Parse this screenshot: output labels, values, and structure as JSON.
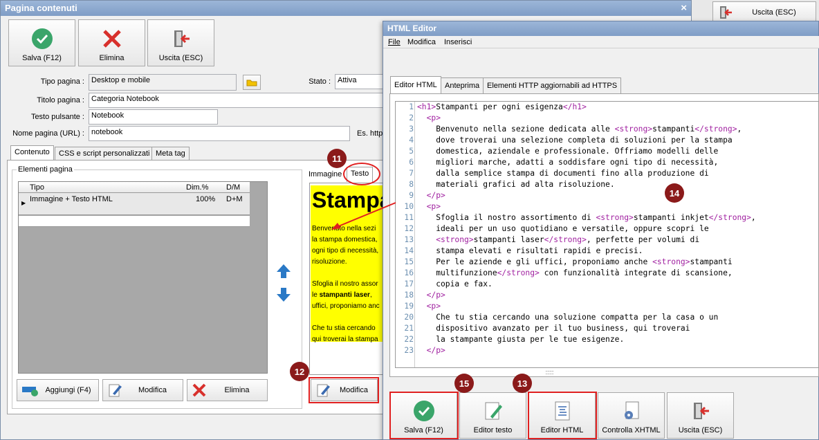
{
  "main_window": {
    "title": "Pagina contenuti",
    "close": "×",
    "toolbar": [
      {
        "label": "Salva (F12)",
        "icon": "check-icon"
      },
      {
        "label": "Elimina",
        "icon": "x-icon"
      },
      {
        "label": "Uscita (ESC)",
        "icon": "exit-icon"
      }
    ],
    "fields": {
      "tipo_pagina_label": "Tipo pagina :",
      "tipo_pagina": "Desktop e mobile",
      "titolo_label": "Titolo pagina :",
      "titolo": "Categoria Notebook",
      "testo_pulsante_label": "Testo pulsante :",
      "testo_pulsante": "Notebook",
      "nome_pagina_label": "Nome pagina (URL) :",
      "nome_pagina": "notebook",
      "stato_label": "Stato :",
      "stato": "Attiva",
      "es_label": "Es. http"
    },
    "tabs": [
      "Contenuto",
      "CSS e script personalizzati",
      "Meta tag"
    ],
    "elementi_label": "Elementi pagina",
    "grid": {
      "headers": [
        "Tipo",
        "Dim.%",
        "D/M"
      ],
      "rows": [
        {
          "tipo": "Immagine + Testo HTML",
          "dim": "100%",
          "dm": "D+M"
        }
      ]
    },
    "buttons": {
      "aggiungi": "Aggiungi (F4)",
      "modifica": "Modifica",
      "elimina": "Elimina",
      "modifica2": "Modifica"
    },
    "preview_tabs": [
      "Immagine",
      "Testo"
    ],
    "preview": {
      "heading": "Stampa",
      "p1": [
        "Benvenuto nella sezi",
        "la stampa domestica,",
        "ogni tipo di necessità,",
        "risoluzione."
      ],
      "p2a": "Sfoglia il nostro assor",
      "p2b": "le ",
      "p2bold": "stampanti laser",
      "p2c": ",",
      "p2d": "uffici, proponiamo anc",
      "p3": [
        "Che tu stia cercando",
        "qui troverai la stampa"
      ]
    },
    "top_right_exit": "Uscita (ESC)"
  },
  "editor": {
    "title": "HTML Editor",
    "menu": [
      "File",
      "Modifica",
      "Inserisci"
    ],
    "tabs": [
      "Editor HTML",
      "Anteprima",
      "Elementi HTTP aggiornabili ad HTTPS"
    ],
    "footer_buttons": [
      {
        "label": "Salva (F12)",
        "icon": "check-icon"
      },
      {
        "label": "Editor testo",
        "icon": "edit-icon"
      },
      {
        "label": "Editor HTML",
        "icon": "html-doc-icon"
      },
      {
        "label": "Controlla XHTML",
        "icon": "gear-doc-icon"
      },
      {
        "label": "Uscita (ESC)",
        "icon": "exit-icon"
      }
    ],
    "splitter": "::::::::"
  },
  "markers": [
    "11",
    "12",
    "13",
    "14",
    "15"
  ],
  "code_lines": [
    [
      "1",
      "<h1>",
      "Stampanti per ogni esigenza",
      "</h1>"
    ],
    [
      "2",
      "  <p>"
    ],
    [
      "3",
      "    Benvenuto nella sezione dedicata alle ",
      "<strong>",
      "stampanti",
      "</strong>",
      ","
    ],
    [
      "4",
      "    dove troverai una selezione completa di soluzioni per la stampa"
    ],
    [
      "5",
      "    domestica, aziendale e professionale. Offriamo modelli delle"
    ],
    [
      "6",
      "    migliori marche, adatti a soddisfare ogni tipo di necessità,"
    ],
    [
      "7",
      "    dalla semplice stampa di documenti fino alla produzione di"
    ],
    [
      "8",
      "    materiali grafici ad alta risoluzione."
    ],
    [
      "9",
      "  </p>"
    ],
    [
      "10",
      "  <p>"
    ],
    [
      "11",
      "    Sfoglia il nostro assortimento di ",
      "<strong>",
      "stampanti inkjet",
      "</strong>",
      ","
    ],
    [
      "12",
      "    ideali per un uso quotidiano e versatile, oppure scopri le"
    ],
    [
      "13",
      "    ",
      "<strong>",
      "stampanti laser",
      "</strong>",
      ", perfette per volumi di"
    ],
    [
      "14",
      "    stampa elevati e risultati rapidi e precisi."
    ],
    [
      "15",
      "    Per le aziende e gli uffici, proponiamo anche ",
      "<strong>",
      "stampanti"
    ],
    [
      "16",
      "    multifunzione",
      "</strong>",
      " con funzionalità integrate di scansione,"
    ],
    [
      "17",
      "    copia e fax."
    ],
    [
      "18",
      "  </p>"
    ],
    [
      "19",
      "  <p>"
    ],
    [
      "20",
      "    Che tu stia cercando una soluzione compatta per la casa o un"
    ],
    [
      "21",
      "    dispositivo avanzato per il tuo business, qui troverai"
    ],
    [
      "22",
      "    la stampante giusta per le tue esigenze."
    ],
    [
      "23",
      "  </p>"
    ]
  ]
}
